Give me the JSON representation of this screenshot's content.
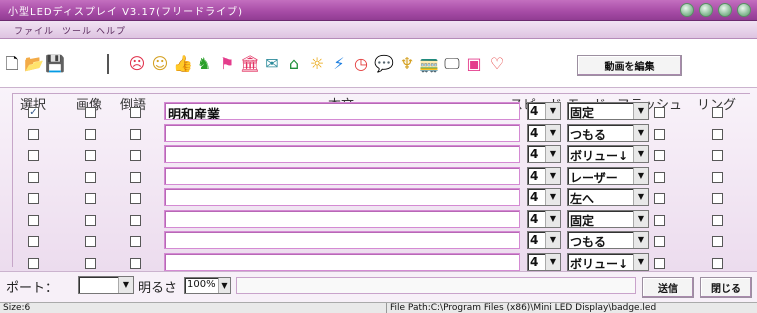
{
  "window": {
    "title": "小型LEDディスプレイ V3.17(フリードライブ)"
  },
  "menu": [
    "ファイル",
    "ツール",
    "ヘルプ"
  ],
  "toolbar": {
    "icons": [
      {
        "name": "new-file-icon",
        "glyph": "🗋",
        "color": "#000"
      },
      {
        "name": "open-folder-icon",
        "glyph": "📂",
        "color": "#000"
      },
      {
        "name": "save-icon",
        "glyph": "💾",
        "color": "#000"
      },
      {
        "name": "angry-face-icon",
        "glyph": "☹",
        "color": "#e0304a"
      },
      {
        "name": "smile-face-icon",
        "glyph": "☺",
        "color": "#d4a020"
      },
      {
        "name": "thumbs-up-icon",
        "glyph": "👍",
        "color": "#c89a10"
      },
      {
        "name": "cat-icon",
        "glyph": "♞",
        "color": "#2aa02a"
      },
      {
        "name": "flag-icon",
        "glyph": "⚑",
        "color": "#e43c8c"
      },
      {
        "name": "building-icon",
        "glyph": "🏛",
        "color": "#e23060"
      },
      {
        "name": "mail-icon",
        "glyph": "✉",
        "color": "#2b8a9a"
      },
      {
        "name": "house-icon",
        "glyph": "⌂",
        "color": "#1f8f3a"
      },
      {
        "name": "sun-icon",
        "glyph": "☼",
        "color": "#e8a000"
      },
      {
        "name": "lightning-icon",
        "glyph": "⚡",
        "color": "#2080e0"
      },
      {
        "name": "clock-icon",
        "glyph": "◷",
        "color": "#e43c3c"
      },
      {
        "name": "speech-bubble-icon",
        "glyph": "💬",
        "color": "#c030c0"
      },
      {
        "name": "party-icon",
        "glyph": "♆",
        "color": "#d4a020"
      },
      {
        "name": "train-icon",
        "glyph": "🚃",
        "color": "#333"
      },
      {
        "name": "monitor-icon",
        "glyph": "🖵",
        "color": "#333"
      },
      {
        "name": "floppy-icon",
        "glyph": "▣",
        "color": "#e43c8c"
      },
      {
        "name": "heart-icon",
        "glyph": "♡",
        "color": "#e43c3c"
      }
    ],
    "edit_video_label": "動画を編集"
  },
  "columns": {
    "select": "選択",
    "image": "画像",
    "reverse": "倒語",
    "text": "本文",
    "speed": "スピード",
    "mode": "モード",
    "flash": "フラッシュ",
    "ring": "リング"
  },
  "rows": [
    {
      "select": true,
      "image": false,
      "reverse": false,
      "text": "明和産業",
      "speed": "4",
      "mode": "固定",
      "flash": false,
      "ring": false
    },
    {
      "select": false,
      "image": false,
      "reverse": false,
      "text": "",
      "speed": "4",
      "mode": "つもる",
      "flash": false,
      "ring": false
    },
    {
      "select": false,
      "image": false,
      "reverse": false,
      "text": "",
      "speed": "4",
      "mode": "ボリュー↓",
      "flash": false,
      "ring": false
    },
    {
      "select": false,
      "image": false,
      "reverse": false,
      "text": "",
      "speed": "4",
      "mode": "レーザー",
      "flash": false,
      "ring": false
    },
    {
      "select": false,
      "image": false,
      "reverse": false,
      "text": "",
      "speed": "4",
      "mode": "左へ",
      "flash": false,
      "ring": false
    },
    {
      "select": false,
      "image": false,
      "reverse": false,
      "text": "",
      "speed": "4",
      "mode": "固定",
      "flash": false,
      "ring": false
    },
    {
      "select": false,
      "image": false,
      "reverse": false,
      "text": "",
      "speed": "4",
      "mode": "つもる",
      "flash": false,
      "ring": false
    },
    {
      "select": false,
      "image": false,
      "reverse": false,
      "text": "",
      "speed": "4",
      "mode": "ボリュー↓",
      "flash": false,
      "ring": false
    }
  ],
  "bottom": {
    "port_label": "ポート：",
    "port_value": "",
    "brightness_label": "明るさ",
    "brightness_value": "100%",
    "send_label": "送信",
    "close_label": "閉じる"
  },
  "status": {
    "size": "Size:6",
    "path": "File Path:C:\\Program Files (x86)\\Mini LED Display\\badge.led"
  }
}
